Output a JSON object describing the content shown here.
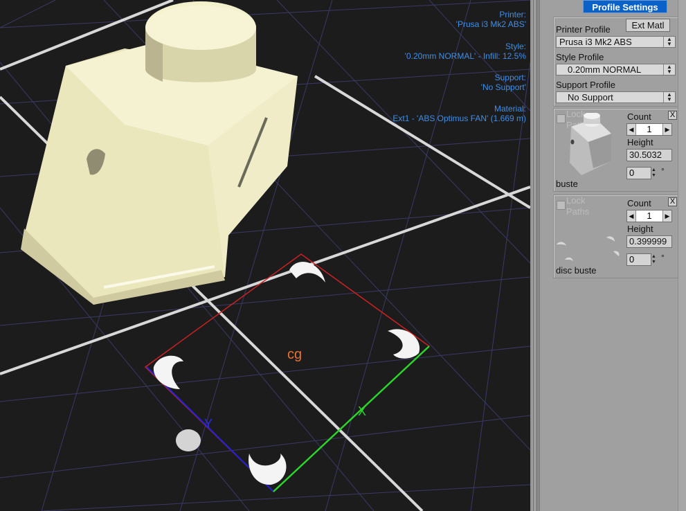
{
  "viewport": {
    "info": {
      "printer_label": "Printer:",
      "printer_value": "'Prusa i3 Mk2 ABS'",
      "style_label": "Style:",
      "style_value": "'0.20mm NORMAL' - Infill: 12.5%",
      "support_label": "Support:",
      "support_value": "'No Support'",
      "material_label": "Material:",
      "material_value": "Ext1 - 'ABS Optimus FAN' (1.669 m)"
    },
    "axes": {
      "x": "X",
      "y": "Y"
    },
    "cg_label": "cg"
  },
  "panel": {
    "tab_label": "Profile Settings",
    "printer_profile_label": "Printer Profile",
    "ext_matl_label": "Ext Matl",
    "printer_profile_value": "Prusa i3 Mk2 ABS",
    "style_profile_label": "Style Profile",
    "style_profile_value": "0.20mm NORMAL",
    "support_profile_label": "Support Profile",
    "support_profile_value": "No Support",
    "objects": [
      {
        "lock_label": "Lock",
        "paths_label": "Paths",
        "count_label": "Count",
        "count_value": "1",
        "height_label": "Height",
        "height_value": "30.5032",
        "angle_value": "0",
        "degree": "°",
        "name": "buste",
        "close": "X"
      },
      {
        "lock_label": "Lock",
        "paths_label": "Paths",
        "count_label": "Count",
        "count_value": "1",
        "height_label": "Height",
        "height_value": "0.399999",
        "angle_value": "0",
        "degree": "°",
        "name": "disc buste",
        "close": "X"
      }
    ]
  },
  "colors": {
    "accent": "#0a62c9",
    "info_text": "#3f8fe8",
    "model": "#f2efc8",
    "x_axis": "#2cd42c",
    "y_axis": "#2222d8",
    "bed_outline": "#cc2222",
    "cg": "#e8712f"
  }
}
